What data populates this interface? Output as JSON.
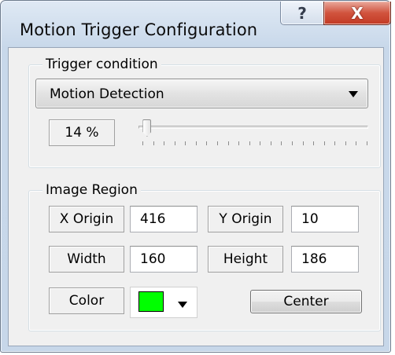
{
  "window": {
    "title": "Motion Trigger Configuration",
    "help_label": "?",
    "close_label": "X"
  },
  "trigger": {
    "group_label": "Trigger condition",
    "condition_value": "Motion Detection",
    "threshold_text": "14 %",
    "slider_fraction": 0.03
  },
  "region": {
    "group_label": "Image Region",
    "x_origin": {
      "label": "X Origin",
      "value": "416"
    },
    "y_origin": {
      "label": "Y Origin",
      "value": "10"
    },
    "width": {
      "label": "Width",
      "value": "160"
    },
    "height": {
      "label": "Height",
      "value": "186"
    },
    "color": {
      "label": "Color",
      "value": "#00ff00"
    },
    "center_label": "Center"
  },
  "colors": {
    "close_red": "#c23a24",
    "frame_blue": "#c8d8ea"
  },
  "icons": {
    "combo_arrow": "chevron-down-icon",
    "color_arrow": "chevron-down-icon"
  }
}
